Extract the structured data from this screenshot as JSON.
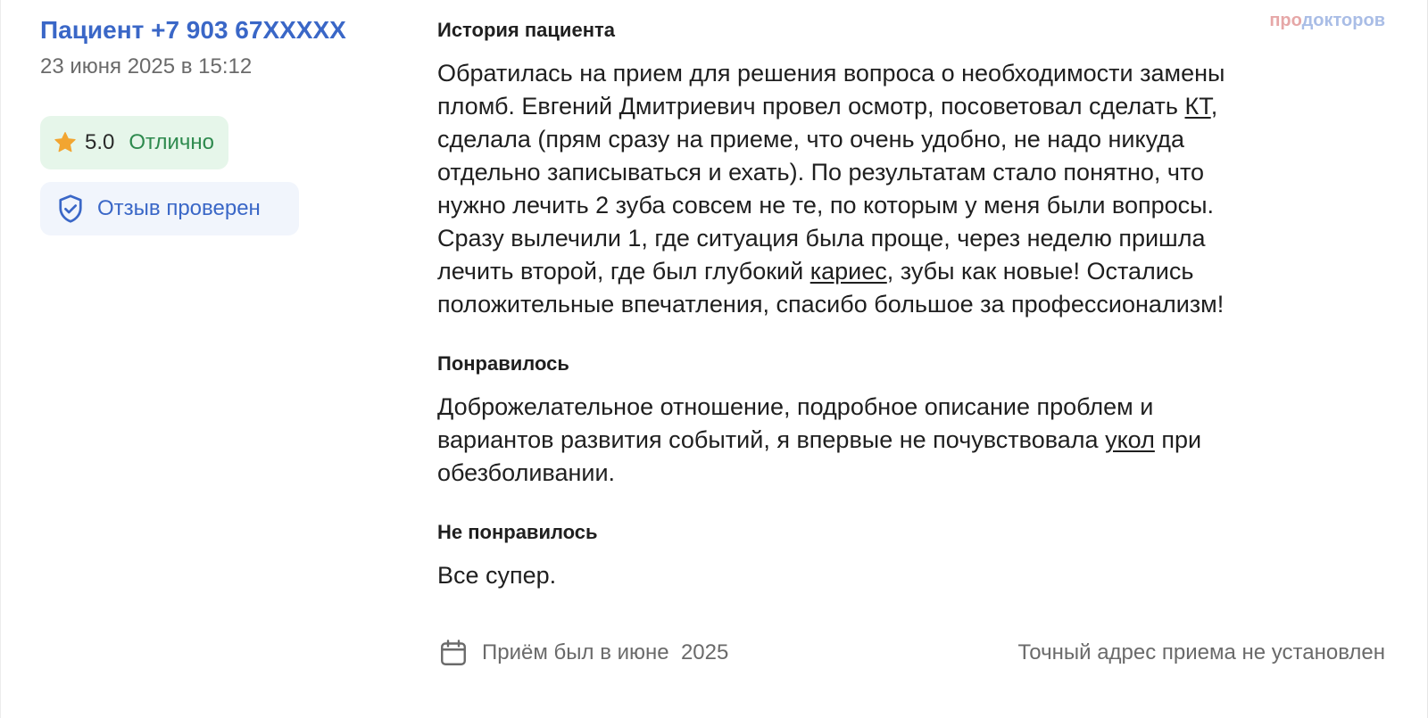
{
  "header": {
    "patient_name": "Пациент +7 903 67XXXXX",
    "date": "23 июня 2025 в 15:12"
  },
  "rating": {
    "value": "5.0",
    "label": "Отлично",
    "icon": "star-icon",
    "badge_color": "#e6f6ea",
    "label_color": "#2e8a4e",
    "star_color": "#f2a531"
  },
  "verified": {
    "label": "Отзыв проверен",
    "icon": "shield-check-icon"
  },
  "brand": {
    "part1": "про",
    "part2": "докторов"
  },
  "history": {
    "heading": "История пациента",
    "line1": "Обратилась на прием для решения вопроса о необходимости замены",
    "line2_a": "пломб. Евгений Дмитриевич провел осмотр, посоветовал сделать ",
    "line2_link": "КТ",
    "line2_b": ",",
    "line3": "сделала (прям сразу на приеме, что очень удобно, не надо никуда",
    "line4": "отдельно записываться и ехать). По результатам стало понятно, что",
    "line5": "нужно лечить 2 зуба совсем не те, по которым у меня были вопросы.",
    "line6": "Сразу вылечили 1, где ситуация была проще, через неделю пришла",
    "line7_a": "лечить второй, где был глубокий ",
    "line7_link": "кариес",
    "line7_b": ", зубы как новые! Остались",
    "line8": "положительные впечатления, спасибо большое за профессионализм!"
  },
  "liked": {
    "heading": "Понравилось",
    "line1": "Доброжелательное отношение, подробное описание проблем и",
    "line2_a": "вариантов развития событий, я впервые не почувствовала ",
    "line2_link": "укол",
    "line2_b": " при",
    "line3": "обезболивании."
  },
  "disliked": {
    "heading": "Не понравилось",
    "text": "Все супер."
  },
  "footer": {
    "visit_text": "Приём был в июне  2025",
    "address_text": "Точный адрес приема не установлен",
    "icon": "calendar-icon"
  },
  "colors": {
    "accent": "#3a67c7",
    "muted": "#6a6a6a"
  }
}
